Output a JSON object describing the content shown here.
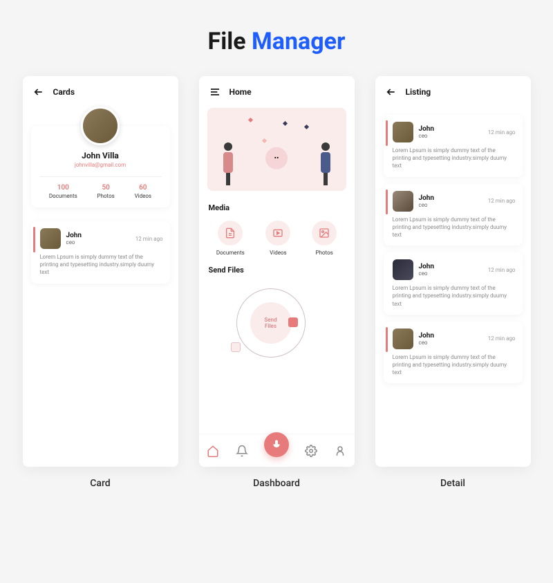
{
  "page_title": {
    "word1": "File",
    "word2": "Manager"
  },
  "screens": {
    "card": {
      "header": "Cards",
      "profile": {
        "name": "John Villa",
        "email": "johnvilla@gmail.com",
        "stats": [
          {
            "value": "100",
            "label": "Documents"
          },
          {
            "value": "50",
            "label": "Photos"
          },
          {
            "value": "60",
            "label": "Videos"
          }
        ]
      },
      "item": {
        "name": "John",
        "role": "ceo",
        "time": "12 min ago",
        "body": "Lorem Lpsum is simply dummy text of the printing and typesetting industry.simply duumy text"
      },
      "label": "Card"
    },
    "dashboard": {
      "header": "Home",
      "media_title": "Media",
      "media": [
        {
          "label": "Documents"
        },
        {
          "label": "Videos"
        },
        {
          "label": "Photos"
        }
      ],
      "send_title": "Send Files",
      "send_button_l1": "Send",
      "send_button_l2": "Files",
      "label": "Dashboard"
    },
    "listing": {
      "header": "Listing",
      "items": [
        {
          "name": "John",
          "role": "ceo",
          "time": "12 min ago",
          "body": "Lorem Lpsum is simply dummy text of the printing and typesetting industry.simply duumy text"
        },
        {
          "name": "John",
          "role": "ceo",
          "time": "12 min ago",
          "body": "Lorem Lpsum is simply dummy text of the printing and typesetting industry.simply duumy text"
        },
        {
          "name": "John",
          "role": "ceo",
          "time": "12 min ago",
          "body": "Lorem Lpsum is simply dummy text of the printing and typesetting industry.simply duumy text"
        },
        {
          "name": "John",
          "role": "ceo",
          "time": "12 min ago",
          "body": "Lorem Lpsum is simply dummy text of the printing and typesetting industry.simply duumy text"
        }
      ],
      "label": "Detail"
    }
  }
}
